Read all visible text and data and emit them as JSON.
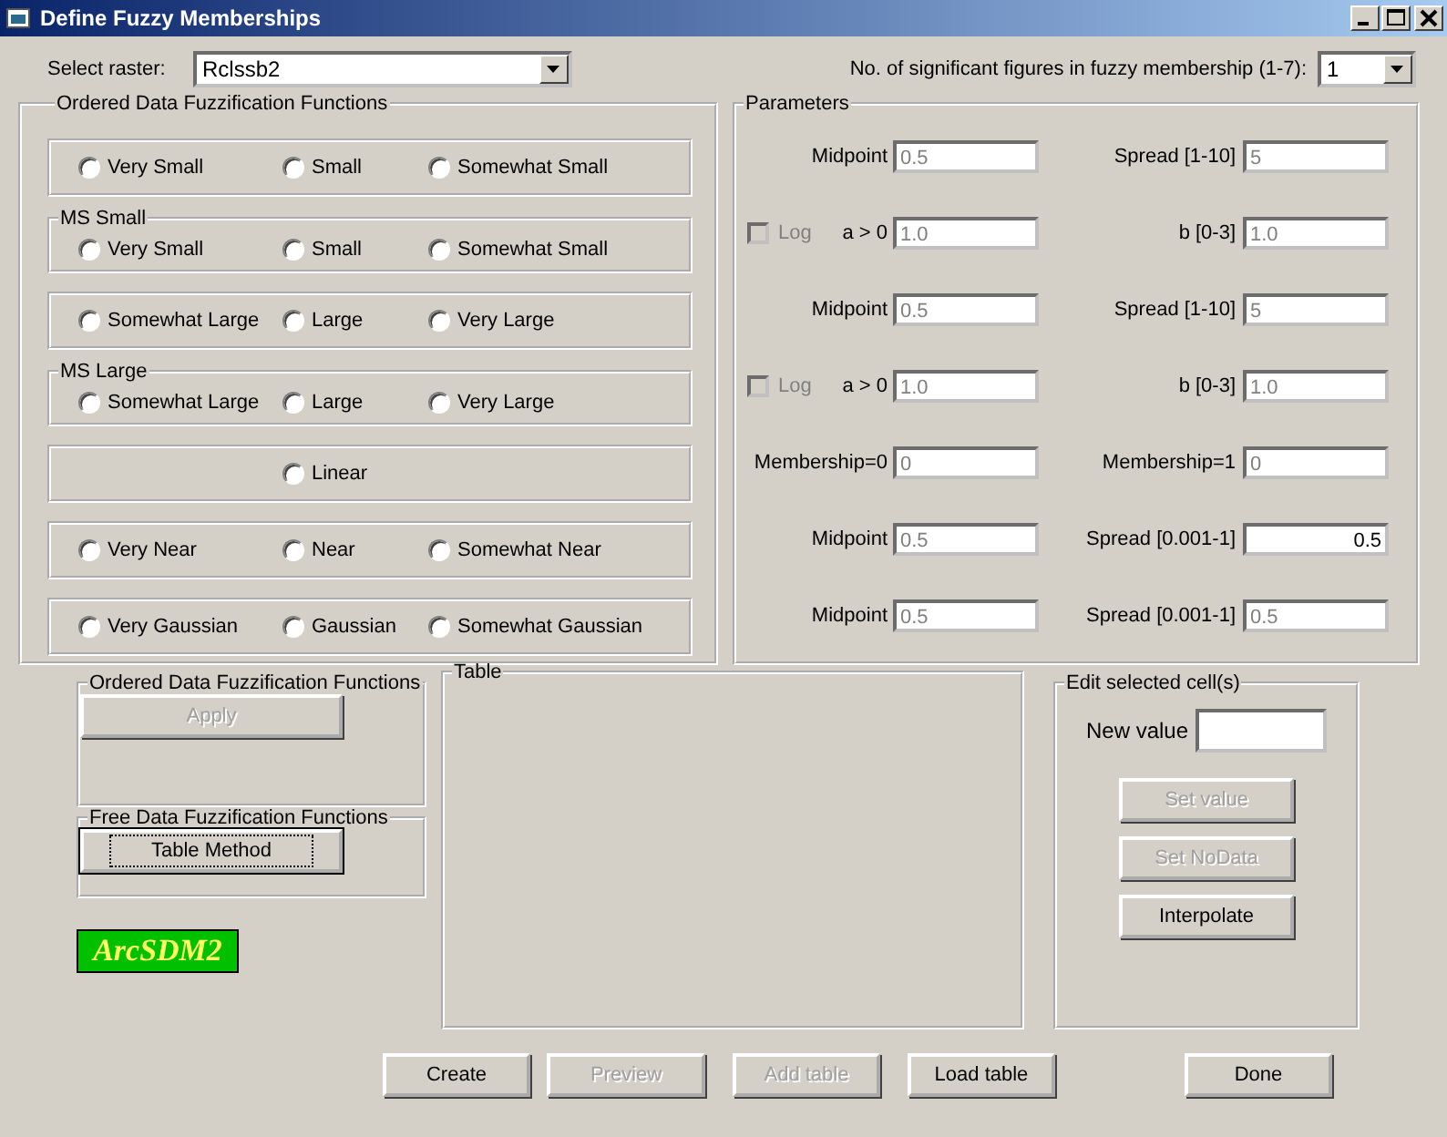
{
  "window": {
    "title": "Define Fuzzy Memberships"
  },
  "select_raster": {
    "label": "Select raster:",
    "value": "Rclssb2"
  },
  "significant_figures": {
    "label": "No. of significant figures in fuzzy membership (1-7):",
    "value": "1"
  },
  "ordered_functions": {
    "title": "Ordered Data Fuzzification Functions",
    "groups": [
      {
        "kind": "triple",
        "options": [
          {
            "label": "Very Small",
            "selected": false
          },
          {
            "label": "Small",
            "selected": false
          },
          {
            "label": "Somewhat Small",
            "selected": false
          }
        ]
      },
      {
        "kind": "triple",
        "title": "MS Small",
        "options": [
          {
            "label": "Very Small",
            "selected": false
          },
          {
            "label": "Small",
            "selected": false
          },
          {
            "label": "Somewhat Small",
            "selected": false
          }
        ]
      },
      {
        "kind": "triple",
        "options": [
          {
            "label": "Somewhat Large",
            "selected": false
          },
          {
            "label": "Large",
            "selected": false
          },
          {
            "label": "Very Large",
            "selected": false
          }
        ]
      },
      {
        "kind": "triple",
        "title": "MS Large",
        "options": [
          {
            "label": "Somewhat Large",
            "selected": false
          },
          {
            "label": "Large",
            "selected": false
          },
          {
            "label": "Very Large",
            "selected": false
          }
        ]
      },
      {
        "kind": "centered",
        "options": [
          {
            "label": "Linear",
            "selected": false
          }
        ]
      },
      {
        "kind": "triple",
        "options": [
          {
            "label": "Very Near",
            "selected": false
          },
          {
            "label": "Near",
            "selected": false
          },
          {
            "label": "Somewhat Near",
            "selected": false
          }
        ]
      },
      {
        "kind": "triple",
        "options": [
          {
            "label": "Very Gaussian",
            "selected": false
          },
          {
            "label": "Gaussian",
            "selected": false
          },
          {
            "label": "Somewhat Gaussian",
            "selected": false
          }
        ]
      }
    ]
  },
  "parameters": {
    "title": "Parameters",
    "rows": [
      {
        "left": {
          "label": "Midpoint",
          "value": "0.5",
          "disabled": true
        },
        "right": {
          "label": "Spread [1-10]",
          "value": "5",
          "disabled": true
        }
      },
      {
        "log": {
          "label": "Log",
          "checked": false,
          "disabled": true
        },
        "left": {
          "label": "a > 0",
          "value": "1.0",
          "disabled": true
        },
        "right": {
          "label": "b [0-3]",
          "value": "1.0",
          "disabled": true
        }
      },
      {
        "left": {
          "label": "Midpoint",
          "value": "0.5",
          "disabled": true
        },
        "right": {
          "label": "Spread [1-10]",
          "value": "5",
          "disabled": true
        }
      },
      {
        "log": {
          "label": "Log",
          "checked": false,
          "disabled": true
        },
        "left": {
          "label": "a > 0",
          "value": "1.0",
          "disabled": true
        },
        "right": {
          "label": "b [0-3]",
          "value": "1.0",
          "disabled": true
        }
      },
      {
        "left": {
          "label": "Membership=0",
          "value": "0",
          "disabled": true
        },
        "right": {
          "label": "Membership=1",
          "value": "0",
          "disabled": true
        }
      },
      {
        "left": {
          "label": "Midpoint",
          "value": "0.5",
          "disabled": true
        },
        "right": {
          "label": "Spread [0.001-1]",
          "value": "0.5",
          "disabled": false
        }
      },
      {
        "left": {
          "label": "Midpoint",
          "value": "0.5",
          "disabled": true
        },
        "right": {
          "label": "Spread [0.001-1]",
          "value": "0.5",
          "disabled": true
        }
      }
    ]
  },
  "ordered_apply": {
    "title": "Ordered Data Fuzzification Functions",
    "button": {
      "label": "Apply",
      "disabled": true,
      "focused": false
    }
  },
  "free_functions": {
    "title": "Free Data Fuzzification Functions",
    "button": {
      "label": "Table Method",
      "disabled": false,
      "focused": true
    }
  },
  "logo": {
    "text": "ArcSDM2"
  },
  "table": {
    "title": "Table"
  },
  "edit_cells": {
    "title": "Edit selected cell(s)",
    "new_value_label": "New value",
    "buttons": [
      {
        "label": "Set value",
        "disabled": true
      },
      {
        "label": "Set NoData",
        "disabled": true
      },
      {
        "label": "Interpolate",
        "disabled": false
      }
    ]
  },
  "footer_buttons": [
    {
      "label": "Create",
      "disabled": false
    },
    {
      "label": "Preview",
      "disabled": true
    },
    {
      "label": "Add table",
      "disabled": true
    },
    {
      "label": "Load table",
      "disabled": false
    },
    {
      "label": "Done",
      "disabled": false
    }
  ]
}
